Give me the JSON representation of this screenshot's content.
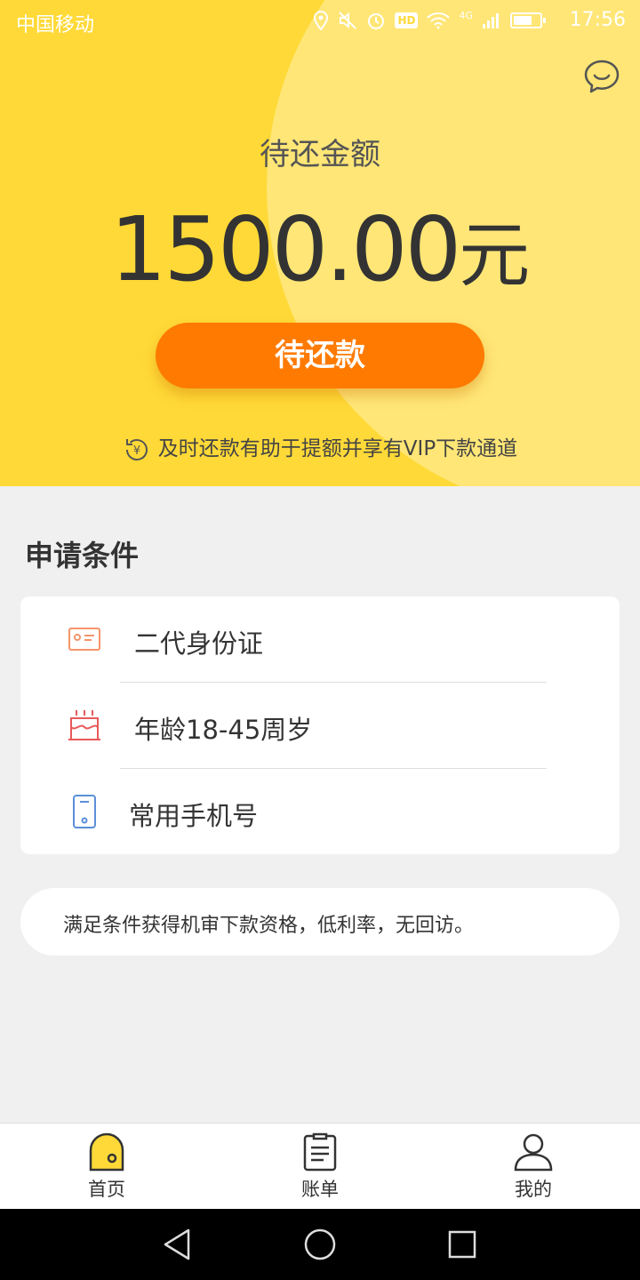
{
  "status_bar": {
    "carrier": "中国移动",
    "time": "17:56",
    "icons": [
      "location-icon",
      "mute-icon",
      "alarm-icon",
      "hd-icon",
      "wifi-icon",
      "signal-icon",
      "battery-icon"
    ],
    "hd": "HD",
    "net": "4G"
  },
  "hero": {
    "label": "待还金额",
    "amount": "1500.00",
    "unit": "元",
    "button_label": "待还款",
    "tip": "及时还款有助于提额并享有VIP下款通道",
    "tip_icon_glyph": "¥",
    "accent_color": "#ffd937",
    "button_color": "#ff7a00"
  },
  "conditions": {
    "title": "申请条件",
    "items": [
      {
        "label": "二代身份证",
        "icon": "id-card-icon"
      },
      {
        "label": "年龄18-45周岁",
        "icon": "birthday-cake-icon"
      },
      {
        "label": "常用手机号",
        "icon": "mobile-phone-icon"
      }
    ]
  },
  "notice": {
    "text": "满足条件获得机审下款资格，低利率，无回访。"
  },
  "tabbar": {
    "tabs": [
      {
        "label": "首页",
        "icon": "home-icon",
        "active": true
      },
      {
        "label": "账单",
        "icon": "bill-icon",
        "active": false
      },
      {
        "label": "我的",
        "icon": "profile-icon",
        "active": false
      }
    ]
  },
  "navbar": {
    "buttons": [
      "back-icon",
      "home-circle-icon",
      "recents-icon"
    ]
  }
}
